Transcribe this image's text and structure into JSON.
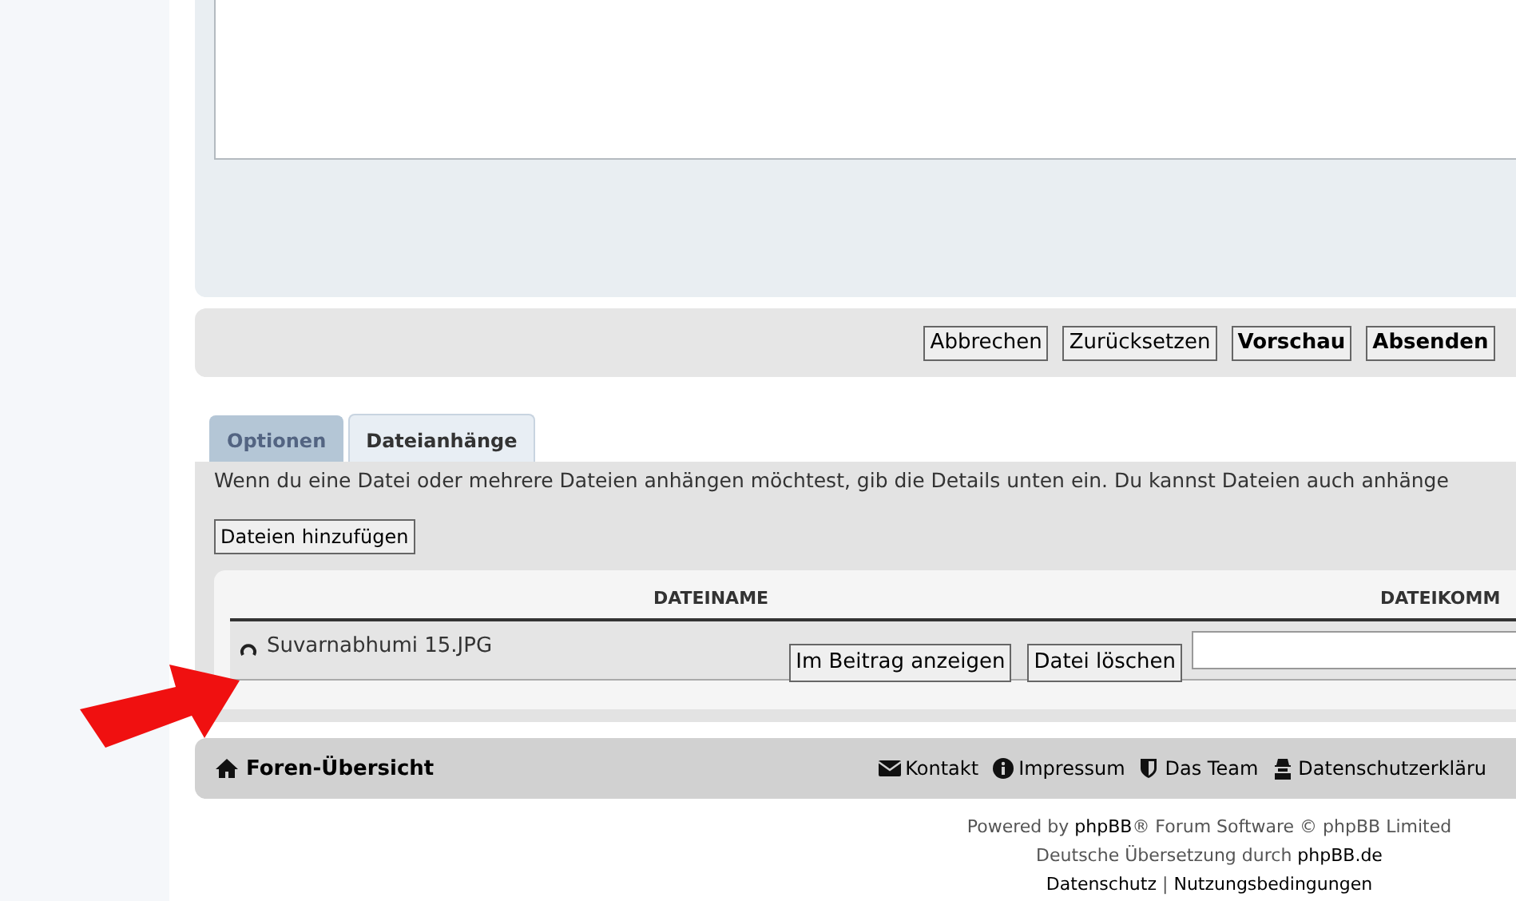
{
  "actions": [
    {
      "label": "Abbrechen",
      "primary": false
    },
    {
      "label": "Zurücksetzen",
      "primary": false
    },
    {
      "label": "Vorschau",
      "primary": true
    },
    {
      "label": "Absenden",
      "primary": true
    }
  ],
  "tabs": [
    {
      "label": "Optionen",
      "selected": false
    },
    {
      "label": "Dateianhänge",
      "selected": true
    }
  ],
  "attachments": {
    "description": "Wenn du eine Datei oder mehrere Dateien anhängen möchtest, gib die Details unten ein. Du kannst Dateien auch anhänge",
    "add_button": "Dateien hinzufügen",
    "columns": [
      "DATEINAME",
      "DATEIKOMM"
    ],
    "rows": [
      {
        "filename": "Suvarnabhumi 15.JPG",
        "show_button": "Im Beitrag anzeigen",
        "delete_button": "Datei löschen"
      }
    ]
  },
  "nav": {
    "home": "Foren-Übersicht",
    "links": [
      {
        "kind": "mail",
        "label": "Kontakt"
      },
      {
        "kind": "info",
        "label": "Impressum"
      },
      {
        "kind": "shield",
        "label": "Das Team"
      },
      {
        "kind": "lock",
        "label": "Datenschutzerkläru"
      }
    ]
  },
  "footer": {
    "powered": {
      "before": "Powered by ",
      "link": "phpBB",
      "after": "® Forum Software © phpBB Limited"
    },
    "translation": {
      "before": "Deutsche Übersetzung durch ",
      "link": "phpBB.de"
    },
    "links": [
      "Datenschutz",
      "Nutzungsbedingungen"
    ],
    "separator": "|"
  }
}
